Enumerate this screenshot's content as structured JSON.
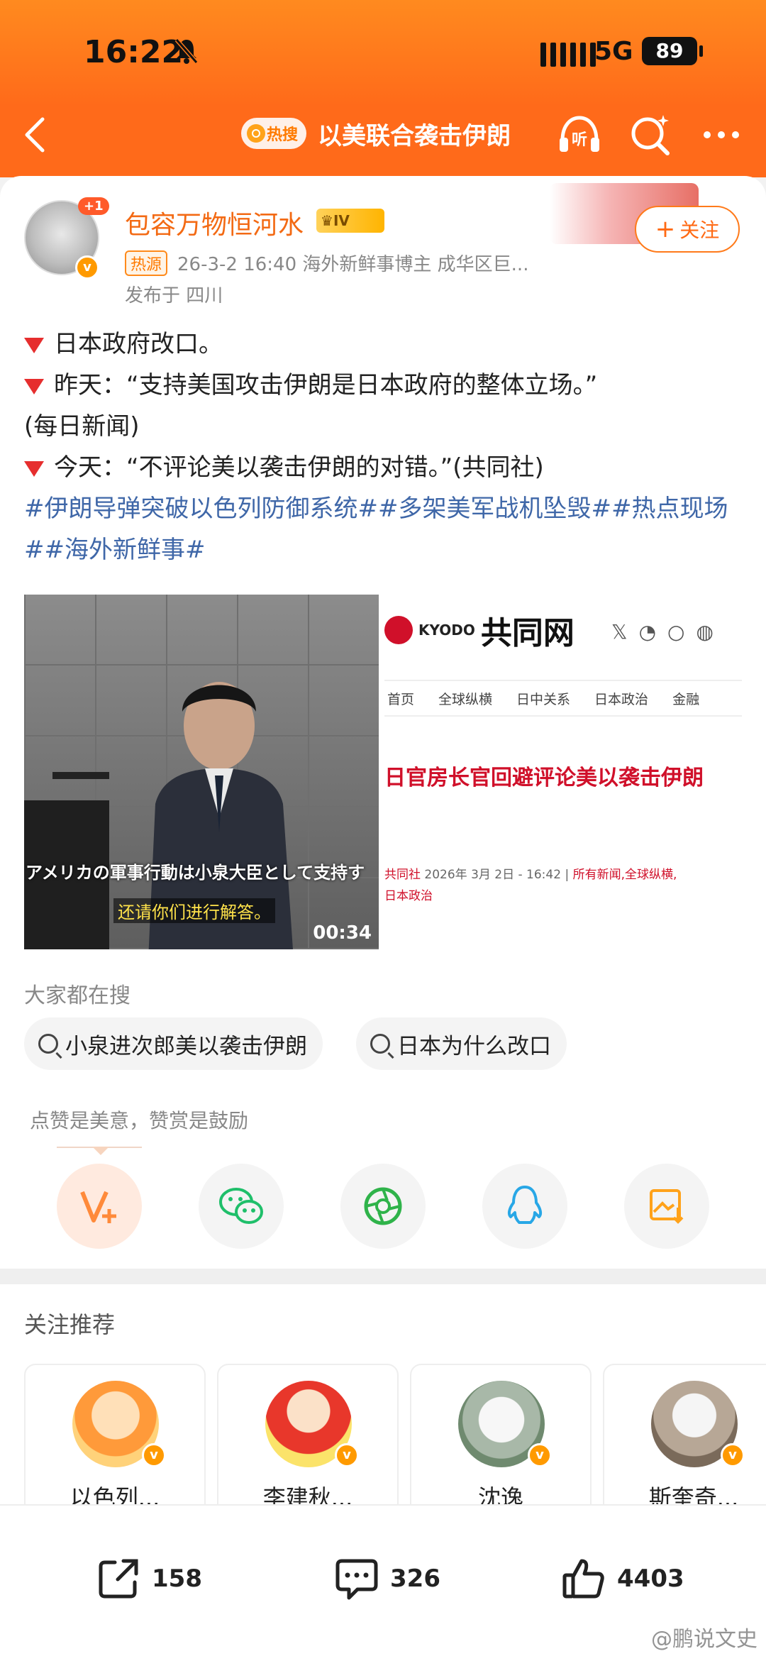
{
  "status": {
    "time": "16:22",
    "network": "5G",
    "battery": "89"
  },
  "nav": {
    "hot_label": "热搜",
    "title": "以美联合袭击伊朗",
    "listen_label": "听"
  },
  "post": {
    "follow_badge": "+1",
    "username": "包容万物恒河水",
    "level": "IV",
    "hot_source": "热源",
    "meta": "26-3-2 16:40  海外新鲜事博主 成华区巨...",
    "published": "发布于 四川",
    "follow_label": "关注",
    "lines": [
      "日本政府改口。",
      "昨天：“支持美国攻击伊朗是日本政府的整体立场。”",
      "(每日新闻)",
      "今天：“不评论美以袭击伊朗的对错。”(共同社)"
    ],
    "tags": "#伊朗导弹突破以色列防御系统##多架美军战机坠毁##热点现场##海外新鲜事#"
  },
  "video": {
    "subtitle_jp": "アメリカの軍事行動は小泉大臣として支持す",
    "subtitle_cn": "还请你们进行解答。",
    "duration": "00:34"
  },
  "kyodo": {
    "brand": "KYODO",
    "site": "共同网",
    "nav": [
      "首页",
      "全球纵横",
      "日中关系",
      "日本政治",
      "金融"
    ],
    "headline": "日官房长官回避评论美以袭击伊朗",
    "byline_source": "共同社",
    "byline_date": "2026年 3月 2日 - 16:42",
    "byline_cats": "所有新闻,全球纵横,",
    "byline_cat2": "日本政治"
  },
  "search": {
    "label": "大家都在搜",
    "chips": [
      "小泉进次郎美以袭击伊朗",
      "日本为什么改口"
    ]
  },
  "praise_text": "点赞是美意，赞赏是鼓励",
  "recommend": {
    "title": "关注推荐",
    "users": [
      "以色列...",
      "李建秋...",
      "沈逸",
      "斯奎奇..."
    ]
  },
  "actions": {
    "share": "158",
    "comment": "326",
    "like": "4403"
  },
  "watermark": "@鹏说文史",
  "colors": {
    "accent": "#ff6a14",
    "tag_blue": "#3f67a8",
    "verified": "#ff9a00"
  }
}
